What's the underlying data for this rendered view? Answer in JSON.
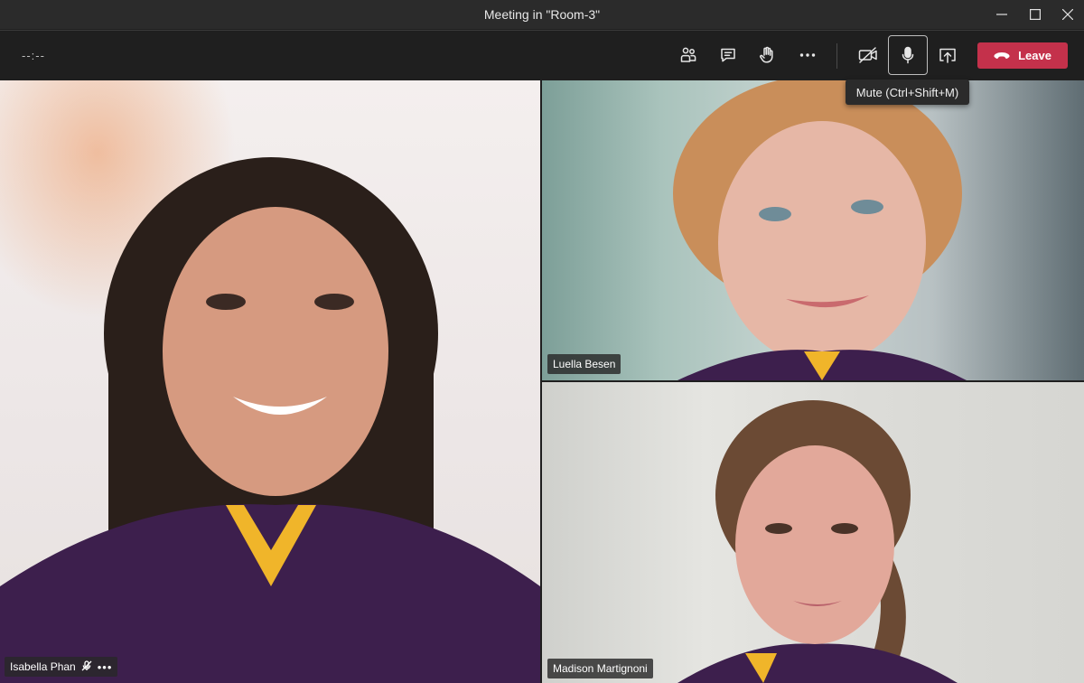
{
  "window": {
    "title": "Meeting in \"Room-3\"",
    "controls": [
      "minimize-icon",
      "maximize-icon",
      "close-icon"
    ]
  },
  "toolbar": {
    "timer": "--:--",
    "buttons": [
      {
        "name": "participants",
        "icon": "people-icon"
      },
      {
        "name": "chat",
        "icon": "chat-icon"
      },
      {
        "name": "raise-hand",
        "icon": "hand-icon"
      },
      {
        "name": "more-actions",
        "icon": "ellipsis-icon"
      },
      {
        "name": "camera",
        "icon": "camera-off-icon"
      },
      {
        "name": "microphone",
        "icon": "microphone-icon"
      },
      {
        "name": "share",
        "icon": "share-screen-icon"
      }
    ],
    "leave_label": "Leave",
    "leave_color": "#c4314b"
  },
  "tooltip": {
    "text": "Mute (Ctrl+Shift+M)"
  },
  "participants": [
    {
      "name": "Isabella Phan",
      "muted": true,
      "icon": "mic-off-icon",
      "more": "•••"
    },
    {
      "name": "Luella Besen"
    },
    {
      "name": "Madison Martignoni"
    }
  ]
}
